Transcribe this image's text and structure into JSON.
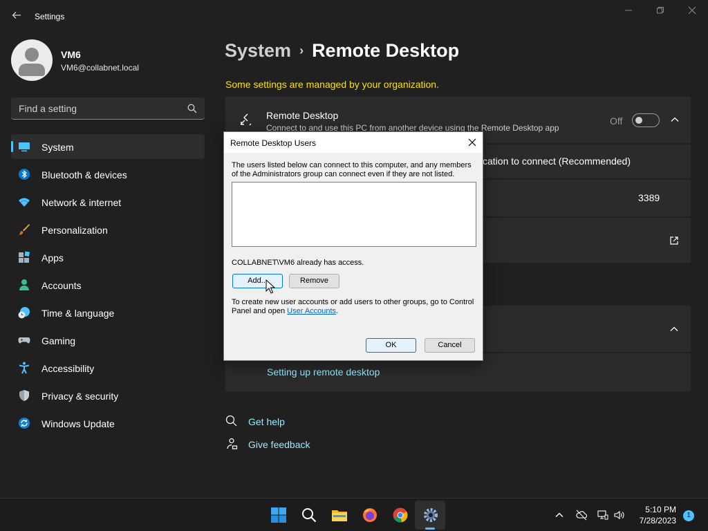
{
  "window": {
    "title": "Settings"
  },
  "user": {
    "name": "VM6",
    "email": "VM6@collabnet.local"
  },
  "search": {
    "placeholder": "Find a setting"
  },
  "sidebar": {
    "items": [
      {
        "label": "System",
        "icon": "system-icon",
        "active": true
      },
      {
        "label": "Bluetooth & devices",
        "icon": "bluetooth-icon"
      },
      {
        "label": "Network & internet",
        "icon": "wifi-icon"
      },
      {
        "label": "Personalization",
        "icon": "brush-icon"
      },
      {
        "label": "Apps",
        "icon": "apps-icon"
      },
      {
        "label": "Accounts",
        "icon": "person-icon"
      },
      {
        "label": "Time & language",
        "icon": "clock-globe-icon"
      },
      {
        "label": "Gaming",
        "icon": "controller-icon"
      },
      {
        "label": "Accessibility",
        "icon": "accessibility-icon"
      },
      {
        "label": "Privacy & security",
        "icon": "shield-icon"
      },
      {
        "label": "Windows Update",
        "icon": "update-icon"
      }
    ]
  },
  "main": {
    "breadcrumb_parent": "System",
    "breadcrumb_sep": "›",
    "breadcrumb_current": "Remote Desktop",
    "managed_note": "Some settings are managed by your organization.",
    "remote_desktop": {
      "title": "Remote Desktop",
      "description": "Connect to and use this PC from another device using the Remote Desktop app",
      "toggle_label": "Off",
      "toggle_on": false
    },
    "nla_fragment": "cation to connect (Recommended)",
    "port_value": "3389",
    "setup_link": "Setting up remote desktop",
    "help": {
      "get_help": "Get help",
      "give_feedback": "Give feedback"
    }
  },
  "dialog": {
    "title": "Remote Desktop Users",
    "description": "The users listed below can connect to this computer, and any members of the Administrators group can connect even if they are not listed.",
    "users": [],
    "access_text": "COLLABNET\\VM6 already has access.",
    "add_label": "Add...",
    "remove_label": "Remove",
    "info_text": "To create new user accounts or add users to other groups, go to Control Panel and open ",
    "info_link": "User Accounts",
    "info_end": ".",
    "ok_label": "OK",
    "cancel_label": "Cancel"
  },
  "taskbar": {
    "time": "5:10 PM",
    "date": "7/28/2023",
    "notification_count": "1"
  },
  "colors": {
    "accent": "#4cc2ff",
    "warning_text": "#fce100",
    "link": "#99ebff"
  }
}
